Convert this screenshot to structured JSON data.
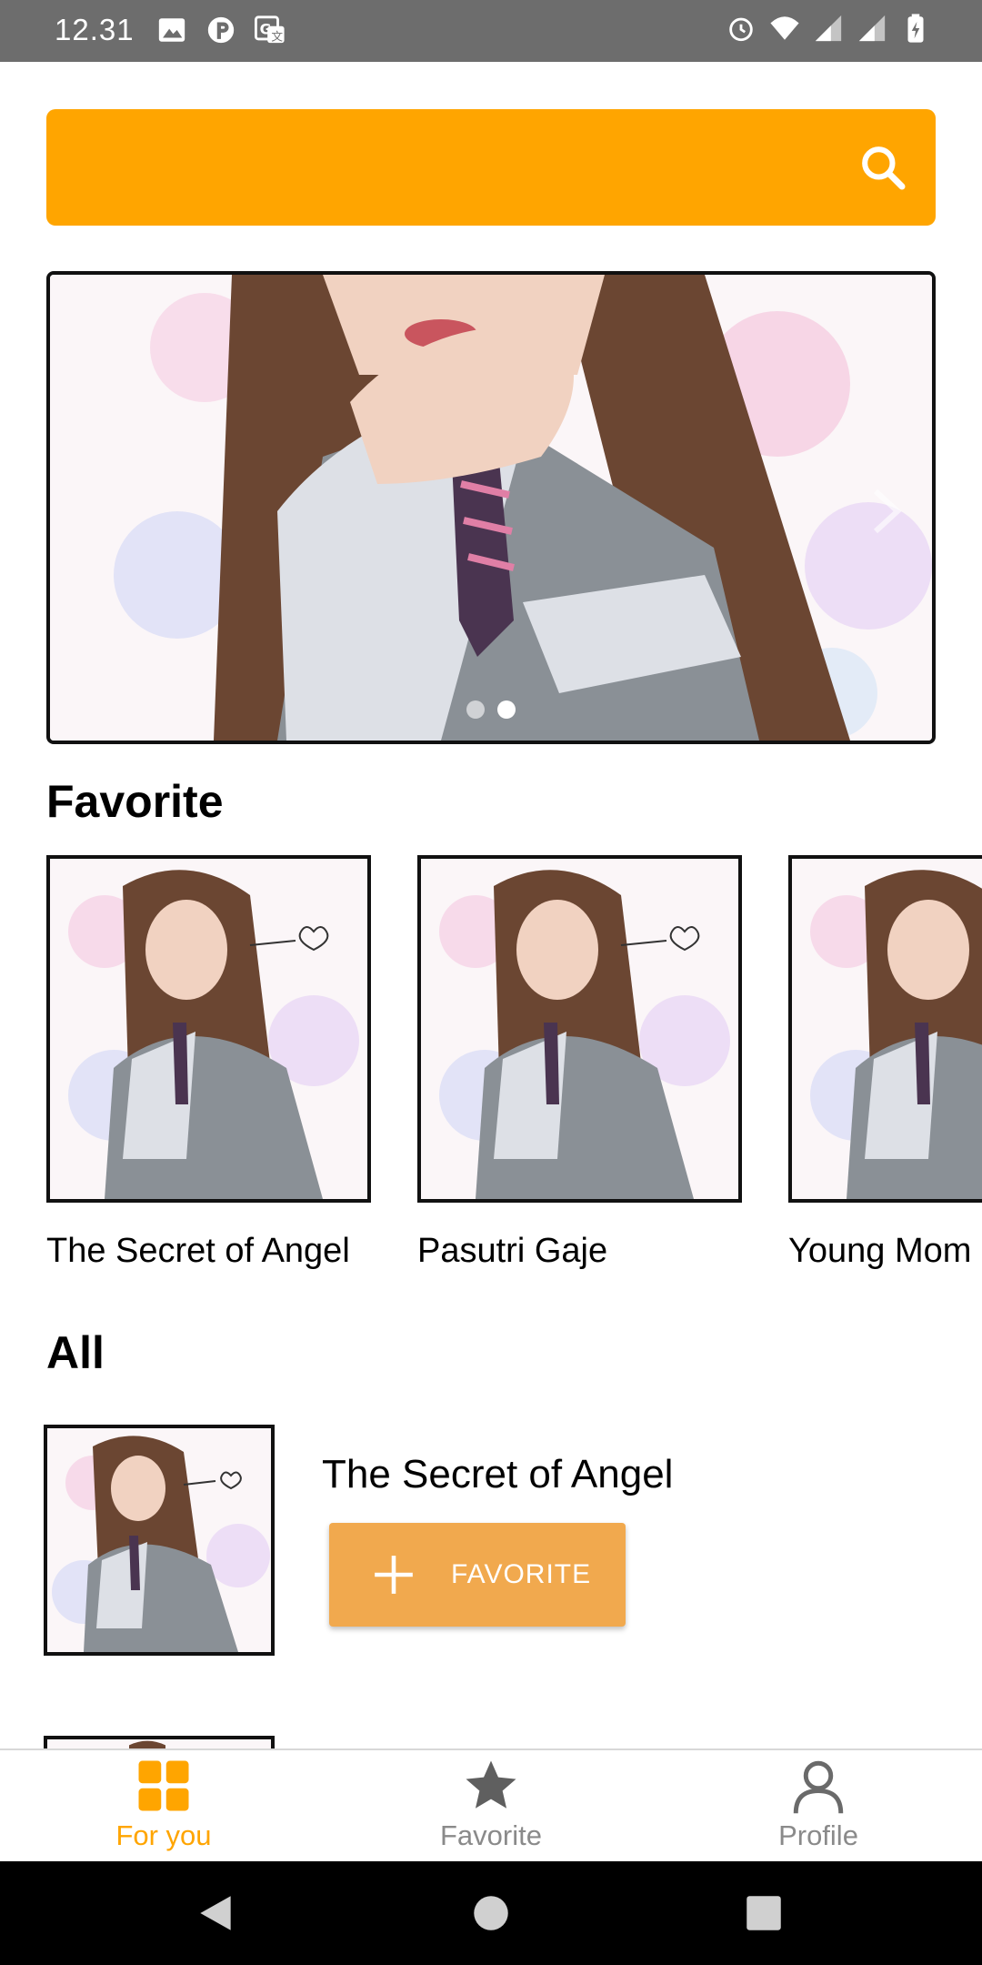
{
  "status_bar": {
    "time": "12.31",
    "left_icons": [
      "image-icon",
      "p-app-icon",
      "translate-icon"
    ],
    "right_icons": [
      "alarm-icon",
      "wifi-icon",
      "signal-icon",
      "signal-icon",
      "battery-icon"
    ]
  },
  "search": {
    "placeholder": "",
    "value": "",
    "color": "#ffa500"
  },
  "banner": {
    "slides": 2,
    "active_slide": 2
  },
  "sections": {
    "favorite_title": "Favorite",
    "all_title": "All"
  },
  "favorites": [
    {
      "title": "The Secret of Angel"
    },
    {
      "title": "Pasutri Gaje"
    },
    {
      "title": "Young Mom"
    }
  ],
  "all": [
    {
      "title": "The Secret of Angel",
      "button_label": "FAVORITE"
    }
  ],
  "bottom_nav": [
    {
      "label": "For you",
      "icon": "grid-icon",
      "active": true
    },
    {
      "label": "Favorite",
      "icon": "star-icon",
      "active": false
    },
    {
      "label": "Profile",
      "icon": "person-icon",
      "active": false
    }
  ],
  "colors": {
    "accent": "#ffa500",
    "button": "#f1a94e",
    "inactive": "#8a8a8a"
  }
}
